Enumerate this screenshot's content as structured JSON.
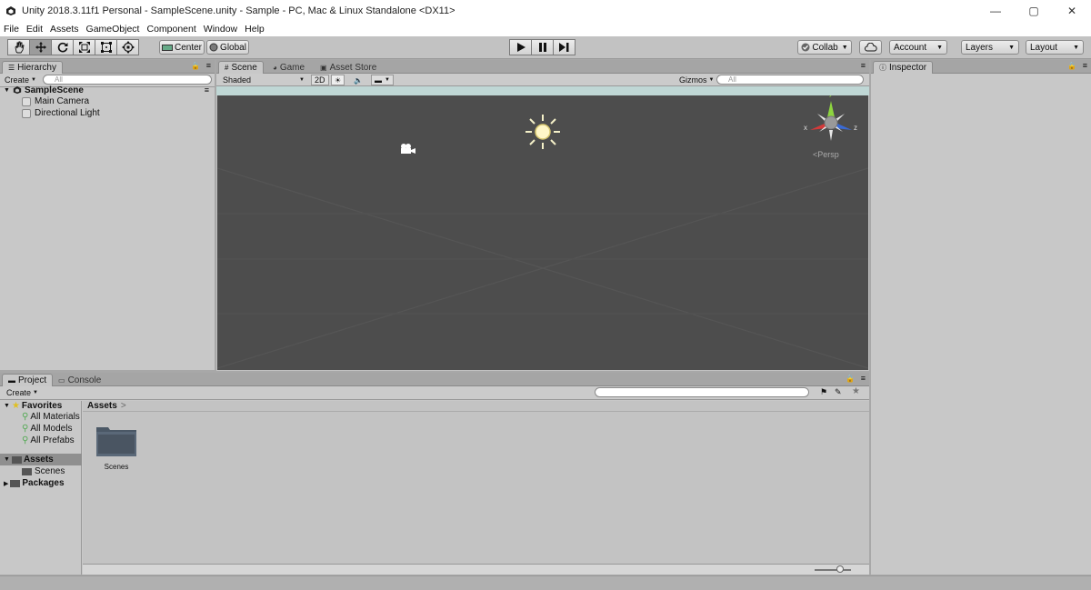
{
  "window": {
    "title": "Unity 2018.3.11f1 Personal - SampleScene.unity - Sample - PC, Mac & Linux Standalone <DX11>",
    "minimize": "—",
    "maximize": "▢",
    "close": "✕"
  },
  "menu": [
    "File",
    "Edit",
    "Assets",
    "GameObject",
    "Component",
    "Window",
    "Help"
  ],
  "toolbar": {
    "tools": [
      "hand-tool",
      "move-tool",
      "rotate-tool",
      "scale-tool",
      "rect-tool",
      "transform-tool"
    ],
    "active_tool": 1,
    "pivot": "Center",
    "space": "Global",
    "collab": "Collab",
    "account": "Account",
    "layers": "Layers",
    "layout": "Layout"
  },
  "hierarchy": {
    "tab": "Hierarchy",
    "create": "Create",
    "search_placeholder": "All",
    "scene": "SampleScene",
    "items": [
      "Main Camera",
      "Directional Light"
    ]
  },
  "scene": {
    "tabs": [
      "Scene",
      "Game",
      "Asset Store"
    ],
    "shading": "Shaded",
    "mode2d": "2D",
    "gizmos": "Gizmos",
    "search_placeholder": "All",
    "persp": "Persp",
    "axis_x": "x",
    "axis_y": "y",
    "axis_z": "z"
  },
  "inspector": {
    "tab": "Inspector"
  },
  "project": {
    "tabs": [
      "Project",
      "Console"
    ],
    "create": "Create",
    "favorites": "Favorites",
    "favorite_items": [
      "All Materials",
      "All Models",
      "All Prefabs"
    ],
    "assets_root": "Assets",
    "asset_children": [
      "Scenes"
    ],
    "packages": "Packages",
    "breadcrumb": "Assets",
    "folders": [
      "Scenes"
    ]
  }
}
